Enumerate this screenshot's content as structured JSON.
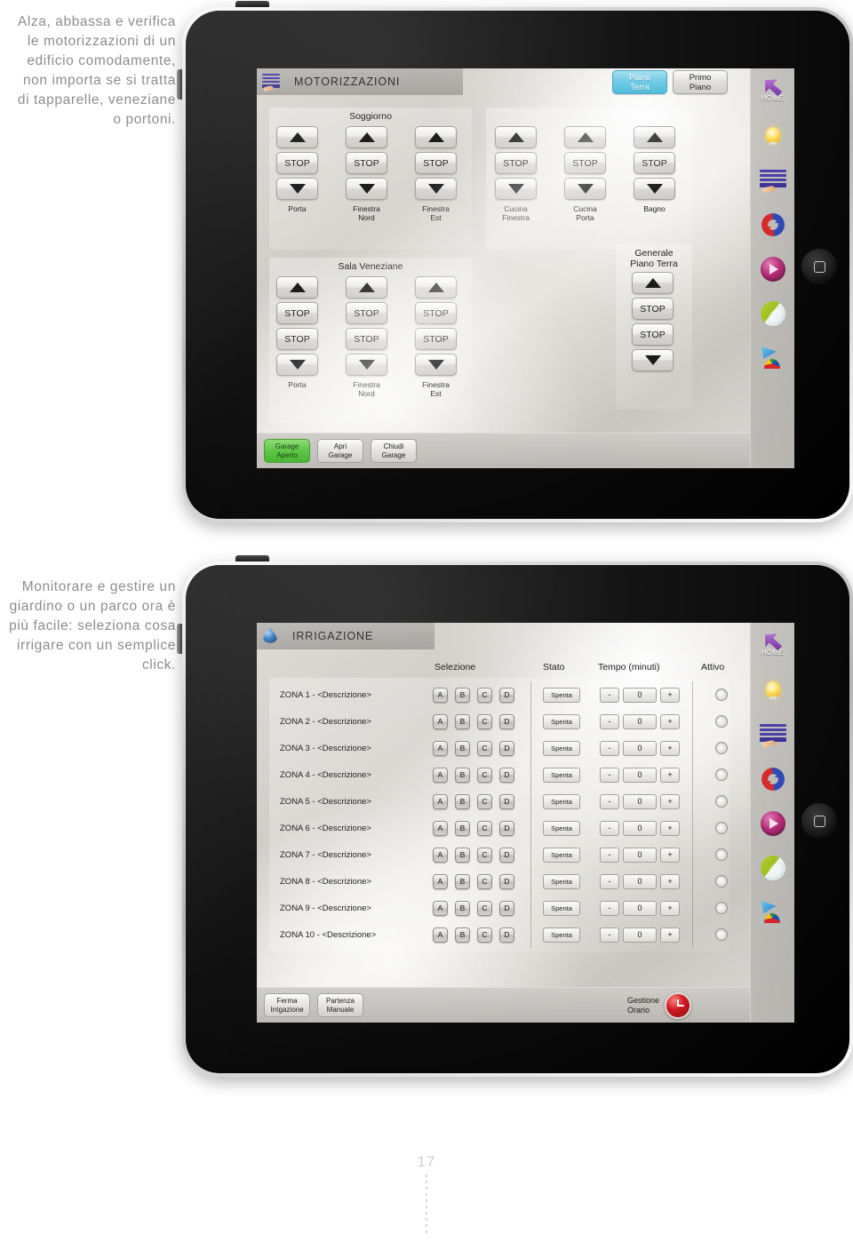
{
  "page": {
    "number": "17"
  },
  "captions": {
    "first": "Alza, abbassa e verifica le motorizzazioni di un edificio comodamente, non importa se si tratta di tapparelle, veneziane o portoni.",
    "second": "Monitorare e gestire un giardino o un parco ora è più facile: seleziona cosa irrigare con un semplice click."
  },
  "screen_motorizzazioni": {
    "title": "MOTORIZZAZIONI",
    "title_icon": "blinds-icon",
    "floor_tabs": [
      {
        "line1": "Piano",
        "line2": "Terra",
        "active": true
      },
      {
        "line1": "Primo",
        "line2": "Piano",
        "active": false
      }
    ],
    "group_soggiorno": {
      "title": "Soggiorno",
      "columns": [
        {
          "label_line1": "Porta",
          "label_line2": "",
          "buttons": [
            "up",
            "STOP",
            "down"
          ]
        },
        {
          "label_line1": "Finestra",
          "label_line2": "Nord",
          "buttons": [
            "up",
            "STOP",
            "down"
          ]
        },
        {
          "label_line1": "Finestra",
          "label_line2": "Est",
          "buttons": [
            "up",
            "STOP",
            "down"
          ]
        }
      ]
    },
    "group_cucina_bagno": {
      "title": "",
      "columns": [
        {
          "label_line1": "Cucina",
          "label_line2": "Finestra",
          "buttons": [
            "up",
            "STOP",
            "down"
          ]
        },
        {
          "label_line1": "Cucina",
          "label_line2": "Porta",
          "buttons": [
            "up",
            "STOP",
            "down"
          ]
        },
        {
          "label_line1": "Bagno",
          "label_line2": "",
          "buttons": [
            "up",
            "STOP",
            "down"
          ]
        }
      ]
    },
    "group_sala_veneziane": {
      "title": "Sala Veneziane",
      "columns": [
        {
          "label_line1": "Porta",
          "label_line2": "",
          "buttons": [
            "up",
            "STOP",
            "STOP",
            "down"
          ]
        },
        {
          "label_line1": "Finestra",
          "label_line2": "Nord",
          "buttons": [
            "up",
            "STOP",
            "STOP",
            "down"
          ]
        },
        {
          "label_line1": "Finestra",
          "label_line2": "Est",
          "buttons": [
            "up",
            "STOP",
            "STOP",
            "down"
          ]
        }
      ]
    },
    "group_generale": {
      "title_line1": "Generale",
      "title_line2": "Piano Terra",
      "buttons": [
        "up",
        "STOP",
        "STOP",
        "down"
      ]
    },
    "bottom_buttons": [
      {
        "line1": "Garage",
        "line2": "Aperto",
        "state": "active-green"
      },
      {
        "line1": "Apri",
        "line2": "Garage",
        "state": "normal"
      },
      {
        "line1": "Chiudi",
        "line2": "Garage",
        "state": "normal"
      }
    ],
    "stop_label": "STOP"
  },
  "screen_irrigazione": {
    "title": "IRRIGAZIONE",
    "title_icon": "water-drop-icon",
    "headers": {
      "selezione": "Selezione",
      "stato": "Stato",
      "tempo": "Tempo (minuti)",
      "attivo": "Attivo"
    },
    "selection_letters": [
      "A",
      "B",
      "C",
      "D"
    ],
    "stato_value": "Spenta",
    "tempo_minus": "-",
    "tempo_value": "0",
    "tempo_plus": "+",
    "zones": [
      {
        "label": "ZONA 1 - <Descrizione>"
      },
      {
        "label": "ZONA 2 - <Descrizione>"
      },
      {
        "label": "ZONA 3 - <Descrizione>"
      },
      {
        "label": "ZONA 4 - <Descrizione>"
      },
      {
        "label": "ZONA 5 - <Descrizione>"
      },
      {
        "label": "ZONA 6 - <Descrizione>"
      },
      {
        "label": "ZONA 7 - <Descrizione>"
      },
      {
        "label": "ZONA 8 - <Descrizione>"
      },
      {
        "label": "ZONA 9 - <Descrizione>"
      },
      {
        "label": "ZONA 10 - <Descrizione>"
      }
    ],
    "bottom_buttons": [
      {
        "line1": "Ferma",
        "line2": "Irrigazione"
      },
      {
        "line1": "Partenza",
        "line2": "Manuale"
      }
    ],
    "gestione": {
      "line1": "Gestione",
      "line2": "Orario",
      "icon": "clock-icon"
    }
  },
  "sidebar": {
    "items": [
      {
        "icon": "home-arrow-icon",
        "label": "HOME"
      },
      {
        "icon": "light-bulb-icon",
        "label": ""
      },
      {
        "icon": "blinds-shutter-icon",
        "label": ""
      },
      {
        "icon": "climate-icon",
        "label": ""
      },
      {
        "icon": "media-play-icon",
        "label": ""
      },
      {
        "icon": "irrigation-icon",
        "label": ""
      },
      {
        "icon": "scenarios-icon",
        "label": ""
      }
    ]
  },
  "colors": {
    "accent_tab": "#52bcda",
    "green_button": "#5cc445",
    "purple": "#6b2f93",
    "red": "#d01b21"
  }
}
